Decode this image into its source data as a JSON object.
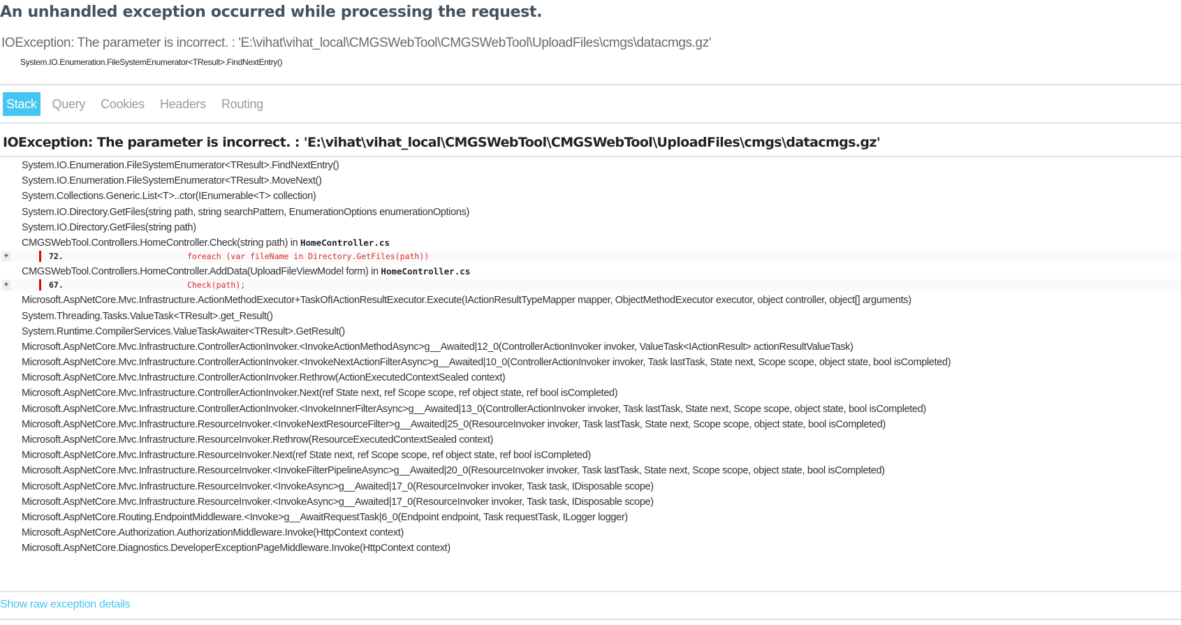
{
  "page": {
    "title": "An unhandled exception occurred while processing the request.",
    "summary": "IOException: The parameter is incorrect. : 'E:\\vihat\\vihat_local\\CMGSWebTool\\CMGSWebTool\\UploadFiles\\cmgs\\datacmgs.gz'",
    "summary_frame": "System.IO.Enumeration.FileSystemEnumerator<TResult>.FindNextEntry()"
  },
  "tabs": [
    {
      "label": "Stack",
      "selected": true
    },
    {
      "label": "Query",
      "selected": false
    },
    {
      "label": "Cookies",
      "selected": false
    },
    {
      "label": "Headers",
      "selected": false
    },
    {
      "label": "Routing",
      "selected": false
    }
  ],
  "stack": {
    "exception_title": "IOException: The parameter is incorrect. : 'E:\\vihat\\vihat_local\\CMGSWebTool\\CMGSWebTool\\UploadFiles\\cmgs\\datacmgs.gz'",
    "frames_before": [
      "System.IO.Enumeration.FileSystemEnumerator<TResult>.FindNextEntry()",
      "System.IO.Enumeration.FileSystemEnumerator<TResult>.MoveNext()",
      "System.Collections.Generic.List<T>..ctor(IEnumerable<T> collection)",
      "System.IO.Directory.GetFiles(string path, string searchPattern, EnumerationOptions enumerationOptions)",
      "System.IO.Directory.GetFiles(string path)"
    ],
    "source_frames": [
      {
        "method": "CMGSWebTool.Controllers.HomeController.Check(string path) in ",
        "file": "HomeController.cs",
        "expand_label": "+",
        "line_number": "72.",
        "code": "            foreach (var fileName in Directory.GetFiles(path))"
      },
      {
        "method": "CMGSWebTool.Controllers.HomeController.AddData(UploadFileViewModel form) in ",
        "file": "HomeController.cs",
        "expand_label": "+",
        "line_number": "67.",
        "code": "            Check(path);"
      }
    ],
    "frames_after": [
      "Microsoft.AspNetCore.Mvc.Infrastructure.ActionMethodExecutor+TaskOfIActionResultExecutor.Execute(IActionResultTypeMapper mapper, ObjectMethodExecutor executor, object controller, object[] arguments)",
      "System.Threading.Tasks.ValueTask<TResult>.get_Result()",
      "System.Runtime.CompilerServices.ValueTaskAwaiter<TResult>.GetResult()",
      "Microsoft.AspNetCore.Mvc.Infrastructure.ControllerActionInvoker.<InvokeActionMethodAsync>g__Awaited|12_0(ControllerActionInvoker invoker, ValueTask<IActionResult> actionResultValueTask)",
      "Microsoft.AspNetCore.Mvc.Infrastructure.ControllerActionInvoker.<InvokeNextActionFilterAsync>g__Awaited|10_0(ControllerActionInvoker invoker, Task lastTask, State next, Scope scope, object state, bool isCompleted)",
      "Microsoft.AspNetCore.Mvc.Infrastructure.ControllerActionInvoker.Rethrow(ActionExecutedContextSealed context)",
      "Microsoft.AspNetCore.Mvc.Infrastructure.ControllerActionInvoker.Next(ref State next, ref Scope scope, ref object state, ref bool isCompleted)",
      "Microsoft.AspNetCore.Mvc.Infrastructure.ControllerActionInvoker.<InvokeInnerFilterAsync>g__Awaited|13_0(ControllerActionInvoker invoker, Task lastTask, State next, Scope scope, object state, bool isCompleted)",
      "Microsoft.AspNetCore.Mvc.Infrastructure.ResourceInvoker.<InvokeNextResourceFilter>g__Awaited|25_0(ResourceInvoker invoker, Task lastTask, State next, Scope scope, object state, bool isCompleted)",
      "Microsoft.AspNetCore.Mvc.Infrastructure.ResourceInvoker.Rethrow(ResourceExecutedContextSealed context)",
      "Microsoft.AspNetCore.Mvc.Infrastructure.ResourceInvoker.Next(ref State next, ref Scope scope, ref object state, ref bool isCompleted)",
      "Microsoft.AspNetCore.Mvc.Infrastructure.ResourceInvoker.<InvokeFilterPipelineAsync>g__Awaited|20_0(ResourceInvoker invoker, Task lastTask, State next, Scope scope, object state, bool isCompleted)",
      "Microsoft.AspNetCore.Mvc.Infrastructure.ResourceInvoker.<InvokeAsync>g__Awaited|17_0(ResourceInvoker invoker, Task task, IDisposable scope)",
      "Microsoft.AspNetCore.Mvc.Infrastructure.ResourceInvoker.<InvokeAsync>g__Awaited|17_0(ResourceInvoker invoker, Task task, IDisposable scope)",
      "Microsoft.AspNetCore.Routing.EndpointMiddleware.<Invoke>g__AwaitRequestTask|6_0(Endpoint endpoint, Task requestTask, ILogger logger)",
      "Microsoft.AspNetCore.Authorization.AuthorizationMiddleware.Invoke(HttpContext context)",
      "Microsoft.AspNetCore.Diagnostics.DeveloperExceptionPageMiddleware.Invoke(HttpContext context)"
    ]
  },
  "footer": {
    "raw_details_link": "Show raw exception details"
  },
  "colors": {
    "accent": "#44c5f2",
    "error_code": "#e0262a",
    "error_bar": "#e3000f",
    "title": "#44525e"
  }
}
